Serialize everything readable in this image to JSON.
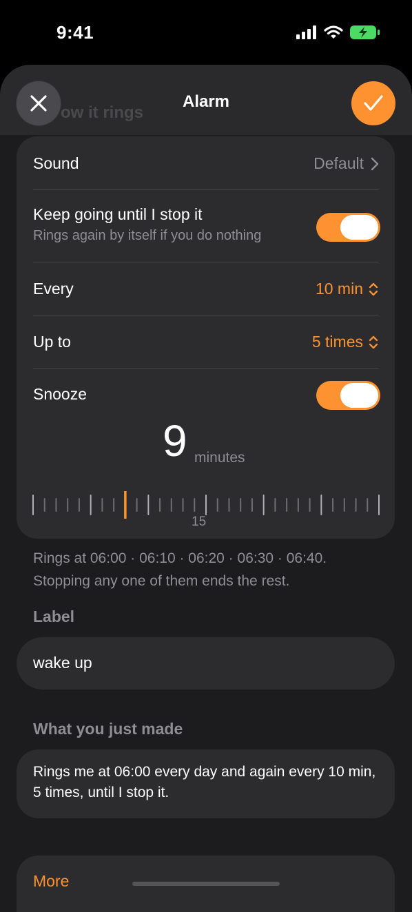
{
  "status": {
    "time": "9:41"
  },
  "header": {
    "title": "Alarm",
    "ghost_text": "ow it rings"
  },
  "sound": {
    "label": "Sound",
    "value": "Default"
  },
  "keep_going": {
    "label": "Keep going until I stop it",
    "sublabel": "Rings again by itself if you do nothing",
    "enabled": true
  },
  "every": {
    "label": "Every",
    "value": "10 min"
  },
  "upto": {
    "label": "Up to",
    "value": "5 times"
  },
  "snooze": {
    "label": "Snooze",
    "enabled": true,
    "value": "9",
    "unit": "minutes",
    "ruler_label": "15"
  },
  "note": {
    "line1": "Rings at 06:00 · 06:10 · 06:20 · 06:30 · 06:40.",
    "line2": "Stopping any one of them ends the rest."
  },
  "label_section": {
    "title": "Label",
    "value": "wake up"
  },
  "summary_section": {
    "title": "What you just made",
    "text": "Rings me at 06:00 every day and again every 10 min, 5 times, until I stop it."
  },
  "more": {
    "label": "More"
  },
  "colors": {
    "accent": "#ff9230",
    "sheet": "#1c1c1e",
    "card": "#2c2c2e"
  }
}
